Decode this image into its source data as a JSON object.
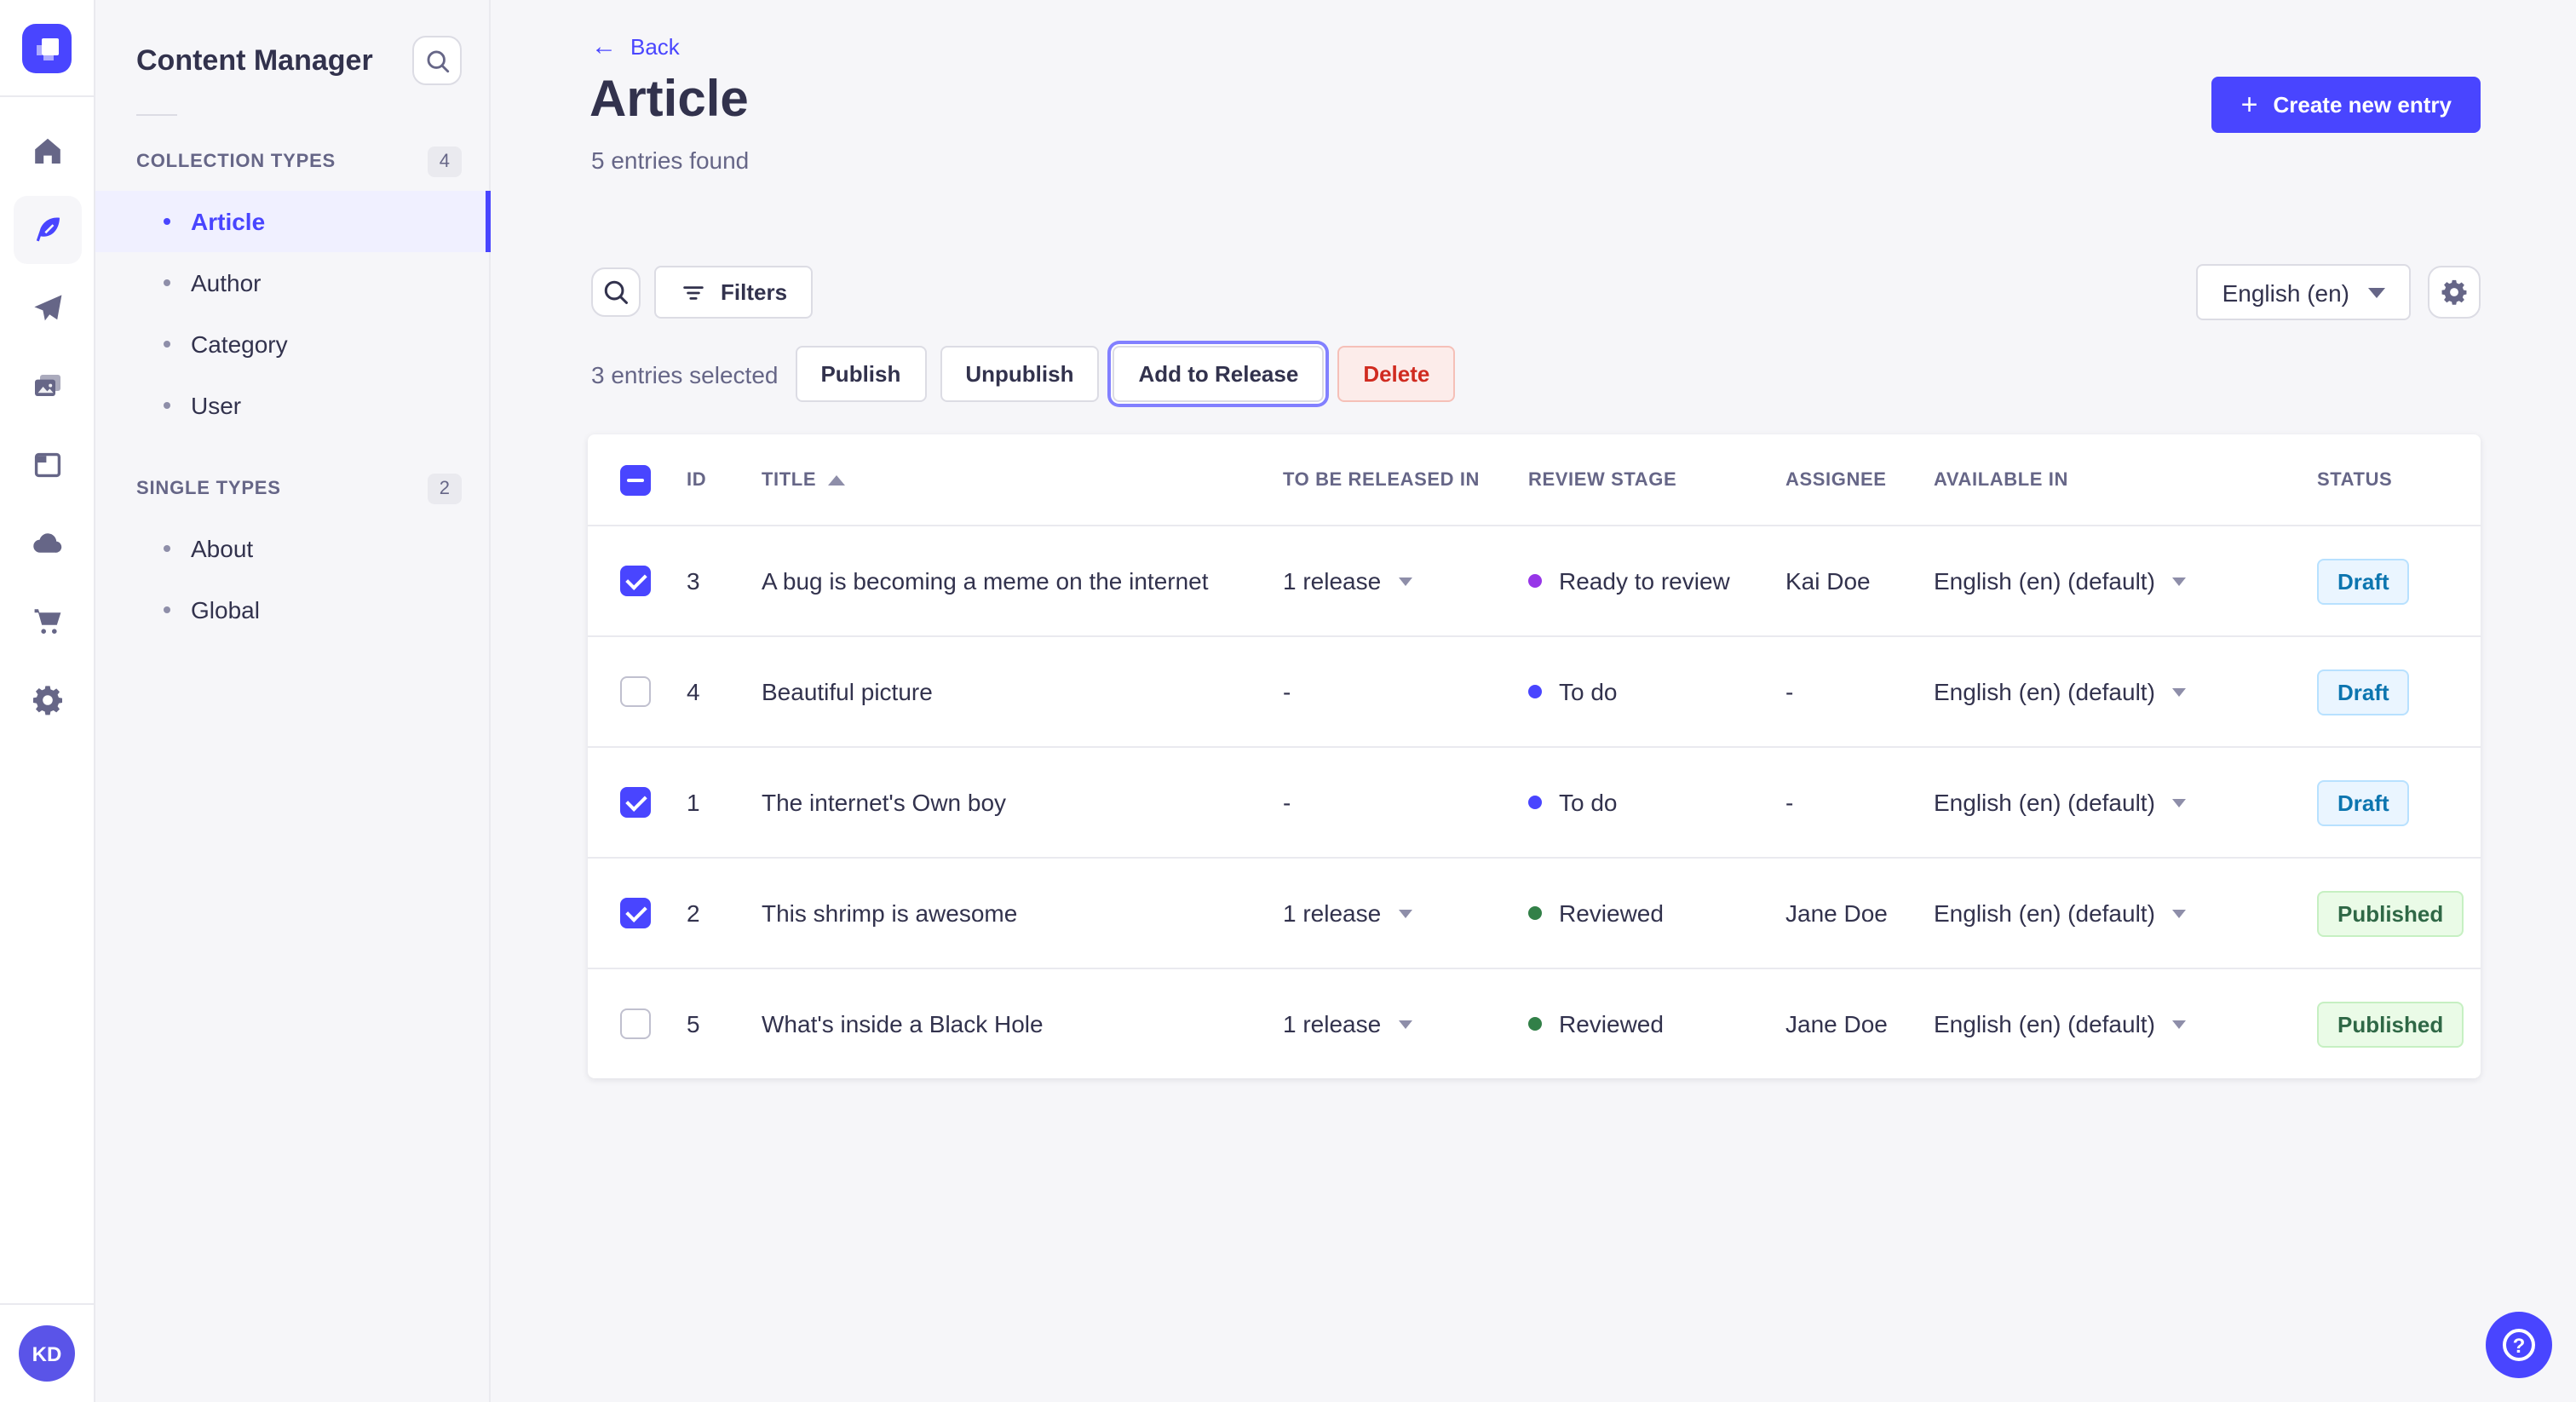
{
  "colors": {
    "accent": "#4945ff",
    "accent_light": "#f0f0ff",
    "danger_text": "#d02b20",
    "danger_bg": "#fcecea",
    "draft_text": "#0c75af",
    "draft_bg": "#eaf5ff",
    "published_text": "#2f6846",
    "published_bg": "#eafbe7",
    "stage_todo": "#4945ff",
    "stage_ready_to_review": "#9736e8",
    "stage_reviewed": "#328048"
  },
  "icons": {
    "plus": "+",
    "back_arrow": "←",
    "help": "?"
  },
  "rail": {
    "items": [
      {
        "name": "home"
      },
      {
        "name": "content-manager",
        "active": true
      },
      {
        "name": "releases"
      },
      {
        "name": "media-library"
      },
      {
        "name": "content-type-builder"
      },
      {
        "name": "cloud"
      },
      {
        "name": "marketplace"
      },
      {
        "name": "settings"
      }
    ],
    "avatar_initials": "KD"
  },
  "subnav": {
    "title": "Content Manager",
    "sections": [
      {
        "label": "COLLECTION TYPES",
        "count": "4",
        "items": [
          {
            "label": "Article",
            "active": true
          },
          {
            "label": "Author"
          },
          {
            "label": "Category"
          },
          {
            "label": "User"
          }
        ]
      },
      {
        "label": "SINGLE TYPES",
        "count": "2",
        "items": [
          {
            "label": "About"
          },
          {
            "label": "Global"
          }
        ]
      }
    ]
  },
  "header": {
    "back": "Back",
    "title": "Article",
    "subtitle": "5 entries found",
    "create": "Create new entry"
  },
  "toolbar": {
    "filters": "Filters",
    "locale": "English (en)"
  },
  "selection": {
    "summary": "3 entries selected",
    "publish": "Publish",
    "unpublish": "Unpublish",
    "add_to_release": "Add to Release",
    "delete": "Delete"
  },
  "table": {
    "header_checkbox": "indeterminate",
    "columns": {
      "id": "ID",
      "title": "TITLE",
      "release": "TO BE RELEASED IN",
      "stage": "REVIEW STAGE",
      "assignee": "ASSIGNEE",
      "available": "AVAILABLE IN",
      "status": "STATUS"
    },
    "rows": [
      {
        "checked": true,
        "id": "3",
        "title": "A bug is becoming a meme on the internet",
        "release": "1 release",
        "release_menu": true,
        "stage": "Ready to review",
        "stage_color": "#9736e8",
        "assignee": "Kai Doe",
        "locale": "English (en) (default)",
        "status": "Draft"
      },
      {
        "checked": false,
        "id": "4",
        "title": "Beautiful picture",
        "release": "-",
        "release_menu": false,
        "stage": "To do",
        "stage_color": "#4945ff",
        "assignee": "-",
        "locale": "English (en) (default)",
        "status": "Draft"
      },
      {
        "checked": true,
        "id": "1",
        "title": "The internet's Own boy",
        "release": "-",
        "release_menu": false,
        "stage": "To do",
        "stage_color": "#4945ff",
        "assignee": "-",
        "locale": "English (en) (default)",
        "status": "Draft"
      },
      {
        "checked": true,
        "id": "2",
        "title": "This shrimp is awesome",
        "release": "1 release",
        "release_menu": true,
        "stage": "Reviewed",
        "stage_color": "#328048",
        "assignee": "Jane Doe",
        "locale": "English (en) (default)",
        "status": "Published"
      },
      {
        "checked": false,
        "id": "5",
        "title": "What's inside a Black Hole",
        "release": "1 release",
        "release_menu": true,
        "stage": "Reviewed",
        "stage_color": "#328048",
        "assignee": "Jane Doe",
        "locale": "English (en) (default)",
        "status": "Published"
      }
    ]
  }
}
